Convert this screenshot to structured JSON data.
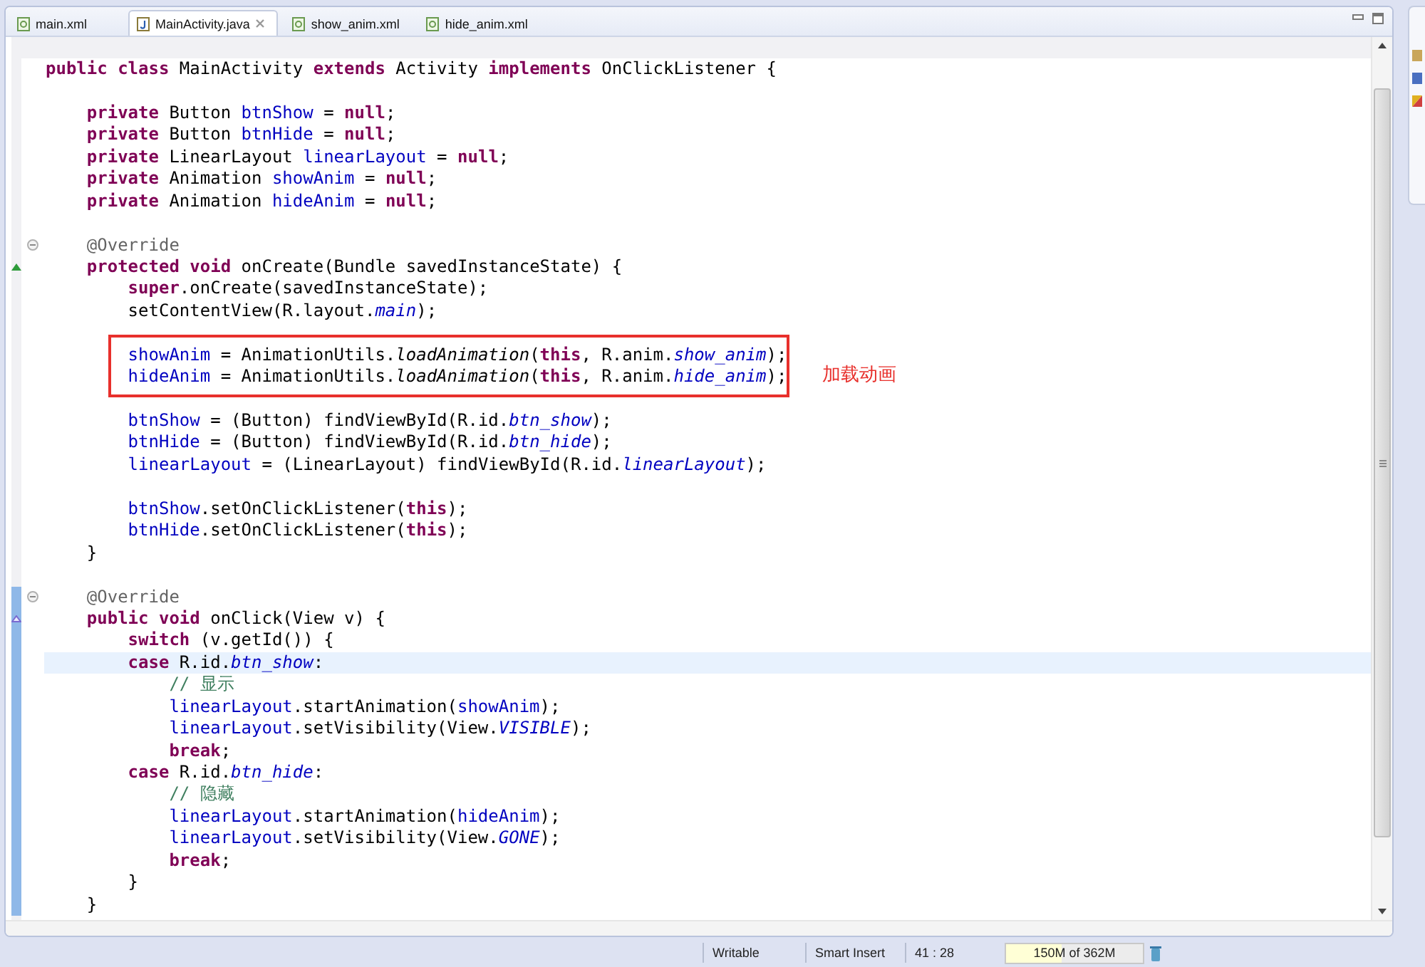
{
  "tabs": [
    {
      "label": "main.xml",
      "kind": "xml",
      "selected": false
    },
    {
      "label": "MainActivity.java",
      "kind": "java",
      "selected": true
    },
    {
      "label": "show_anim.xml",
      "kind": "xml",
      "selected": false
    },
    {
      "label": "hide_anim.xml",
      "kind": "xml",
      "selected": false
    }
  ],
  "editor": {
    "blocks": [
      {
        "range": false,
        "boxed": false,
        "lines": [
          {
            "kind": "code",
            "tokens": [
              {
                "kind": "keyword",
                "text": "public class "
              },
              {
                "kind": "plain",
                "text": "MainActivity "
              },
              {
                "kind": "keyword",
                "text": "extends "
              },
              {
                "kind": "plain",
                "text": "Activity "
              },
              {
                "kind": "keyword",
                "text": "implements "
              },
              {
                "kind": "plain",
                "text": "OnClickListener {"
              }
            ],
            "current": false
          },
          {
            "kind": "blank"
          },
          {
            "kind": "code",
            "tokens": [
              {
                "kind": "keyword",
                "text": "    private "
              },
              {
                "kind": "plain",
                "text": "Button "
              },
              {
                "kind": "field",
                "text": "btnShow"
              },
              {
                "kind": "plain",
                "text": " = "
              },
              {
                "kind": "keyword",
                "text": "null"
              },
              {
                "kind": "plain",
                "text": ";"
              }
            ],
            "current": false
          },
          {
            "kind": "code",
            "tokens": [
              {
                "kind": "keyword",
                "text": "    private "
              },
              {
                "kind": "plain",
                "text": "Button "
              },
              {
                "kind": "field",
                "text": "btnHide"
              },
              {
                "kind": "plain",
                "text": " = "
              },
              {
                "kind": "keyword",
                "text": "null"
              },
              {
                "kind": "plain",
                "text": ";"
              }
            ],
            "current": false
          },
          {
            "kind": "code",
            "tokens": [
              {
                "kind": "keyword",
                "text": "    private "
              },
              {
                "kind": "plain",
                "text": "LinearLayout "
              },
              {
                "kind": "field",
                "text": "linearLayout"
              },
              {
                "kind": "plain",
                "text": " = "
              },
              {
                "kind": "keyword",
                "text": "null"
              },
              {
                "kind": "plain",
                "text": ";"
              }
            ],
            "current": false
          },
          {
            "kind": "code",
            "tokens": [
              {
                "kind": "keyword",
                "text": "    private "
              },
              {
                "kind": "plain",
                "text": "Animation "
              },
              {
                "kind": "field",
                "text": "showAnim"
              },
              {
                "kind": "plain",
                "text": " = "
              },
              {
                "kind": "keyword",
                "text": "null"
              },
              {
                "kind": "plain",
                "text": ";"
              }
            ],
            "current": false
          },
          {
            "kind": "code",
            "tokens": [
              {
                "kind": "keyword",
                "text": "    private "
              },
              {
                "kind": "plain",
                "text": "Animation "
              },
              {
                "kind": "field",
                "text": "hideAnim"
              },
              {
                "kind": "plain",
                "text": " = "
              },
              {
                "kind": "keyword",
                "text": "null"
              },
              {
                "kind": "plain",
                "text": ";"
              }
            ],
            "current": false
          },
          {
            "kind": "blank"
          },
          {
            "kind": "fold",
            "tokens": [
              {
                "kind": "annotation",
                "text": "    @Override"
              }
            ],
            "current": false
          },
          {
            "kind": "override",
            "tokens": [
              {
                "kind": "keyword",
                "text": "    protected void "
              },
              {
                "kind": "plain",
                "text": "onCreate(Bundle savedInstanceState) {"
              }
            ],
            "current": false
          },
          {
            "kind": "code",
            "tokens": [
              {
                "kind": "keyword",
                "text": "        super"
              },
              {
                "kind": "plain",
                "text": ".onCreate(savedInstanceState);"
              }
            ],
            "current": false
          },
          {
            "kind": "code",
            "tokens": [
              {
                "kind": "plain",
                "text": "        setContentView(R.layout."
              },
              {
                "kind": "static",
                "text": "main"
              },
              {
                "kind": "plain",
                "text": ");"
              }
            ],
            "current": false
          },
          {
            "kind": "blank"
          }
        ]
      },
      {
        "range": false,
        "boxed": true,
        "callout": "加载动画",
        "lines": [
          {
            "kind": "code",
            "tokens": [
              {
                "kind": "field",
                "text": "        showAnim"
              },
              {
                "kind": "plain",
                "text": " = AnimationUtils."
              },
              {
                "kind": "static-method",
                "text": "loadAnimation"
              },
              {
                "kind": "plain",
                "text": "("
              },
              {
                "kind": "keyword",
                "text": "this"
              },
              {
                "kind": "plain",
                "text": ", R.anim."
              },
              {
                "kind": "static",
                "text": "show_anim"
              },
              {
                "kind": "plain",
                "text": ");"
              }
            ],
            "current": false
          },
          {
            "kind": "code",
            "tokens": [
              {
                "kind": "field",
                "text": "        hideAnim"
              },
              {
                "kind": "plain",
                "text": " = AnimationUtils."
              },
              {
                "kind": "static-method",
                "text": "loadAnimation"
              },
              {
                "kind": "plain",
                "text": "("
              },
              {
                "kind": "keyword",
                "text": "this"
              },
              {
                "kind": "plain",
                "text": ", R.anim."
              },
              {
                "kind": "static",
                "text": "hide_anim"
              },
              {
                "kind": "plain",
                "text": ");"
              }
            ],
            "current": false
          }
        ]
      },
      {
        "range": false,
        "boxed": false,
        "lines": [
          {
            "kind": "blank"
          },
          {
            "kind": "code",
            "tokens": [
              {
                "kind": "field",
                "text": "        btnShow"
              },
              {
                "kind": "plain",
                "text": " = (Button) findViewById(R.id."
              },
              {
                "kind": "static",
                "text": "btn_show"
              },
              {
                "kind": "plain",
                "text": ");"
              }
            ],
            "current": false
          },
          {
            "kind": "code",
            "tokens": [
              {
                "kind": "field",
                "text": "        btnHide"
              },
              {
                "kind": "plain",
                "text": " = (Button) findViewById(R.id."
              },
              {
                "kind": "static",
                "text": "btn_hide"
              },
              {
                "kind": "plain",
                "text": ");"
              }
            ],
            "current": false
          },
          {
            "kind": "code",
            "tokens": [
              {
                "kind": "field",
                "text": "        linearLayout"
              },
              {
                "kind": "plain",
                "text": " = (LinearLayout) findViewById(R.id."
              },
              {
                "kind": "static",
                "text": "linearLayout"
              },
              {
                "kind": "plain",
                "text": ");"
              }
            ],
            "current": false
          },
          {
            "kind": "blank"
          },
          {
            "kind": "code",
            "tokens": [
              {
                "kind": "field",
                "text": "        btnShow"
              },
              {
                "kind": "plain",
                "text": ".setOnClickListener("
              },
              {
                "kind": "keyword",
                "text": "this"
              },
              {
                "kind": "plain",
                "text": ");"
              }
            ],
            "current": false
          },
          {
            "kind": "code",
            "tokens": [
              {
                "kind": "field",
                "text": "        btnHide"
              },
              {
                "kind": "plain",
                "text": ".setOnClickListener("
              },
              {
                "kind": "keyword",
                "text": "this"
              },
              {
                "kind": "plain",
                "text": ");"
              }
            ],
            "current": false
          },
          {
            "kind": "code",
            "tokens": [
              {
                "kind": "plain",
                "text": "    }"
              }
            ],
            "current": false
          },
          {
            "kind": "blank"
          }
        ]
      },
      {
        "range": true,
        "boxed": false,
        "lines": [
          {
            "kind": "fold",
            "tokens": [
              {
                "kind": "annotation",
                "text": "    @Override"
              }
            ],
            "current": false
          },
          {
            "kind": "implement",
            "tokens": [
              {
                "kind": "keyword",
                "text": "    public void "
              },
              {
                "kind": "plain",
                "text": "onClick(View v) {"
              }
            ],
            "current": false
          },
          {
            "kind": "code",
            "tokens": [
              {
                "kind": "keyword",
                "text": "        switch "
              },
              {
                "kind": "plain",
                "text": "(v.getId()) {"
              }
            ],
            "current": false
          },
          {
            "kind": "code",
            "tokens": [
              {
                "kind": "keyword",
                "text": "        case "
              },
              {
                "kind": "plain",
                "text": "R.id."
              },
              {
                "kind": "static",
                "text": "btn_show"
              },
              {
                "kind": "plain",
                "text": ":"
              }
            ],
            "current": true
          },
          {
            "kind": "code",
            "tokens": [
              {
                "kind": "comment",
                "text": "            // 显示"
              }
            ],
            "current": false
          },
          {
            "kind": "code",
            "tokens": [
              {
                "kind": "field",
                "text": "            linearLayout"
              },
              {
                "kind": "plain",
                "text": ".startAnimation("
              },
              {
                "kind": "field",
                "text": "showAnim"
              },
              {
                "kind": "plain",
                "text": ");"
              }
            ],
            "current": false
          },
          {
            "kind": "code",
            "tokens": [
              {
                "kind": "field",
                "text": "            linearLayout"
              },
              {
                "kind": "plain",
                "text": ".setVisibility(View."
              },
              {
                "kind": "static",
                "text": "VISIBLE"
              },
              {
                "kind": "plain",
                "text": ");"
              }
            ],
            "current": false
          },
          {
            "kind": "code",
            "tokens": [
              {
                "kind": "keyword",
                "text": "            break"
              },
              {
                "kind": "plain",
                "text": ";"
              }
            ],
            "current": false
          },
          {
            "kind": "code",
            "tokens": [
              {
                "kind": "keyword",
                "text": "        case "
              },
              {
                "kind": "plain",
                "text": "R.id."
              },
              {
                "kind": "static",
                "text": "btn_hide"
              },
              {
                "kind": "plain",
                "text": ":"
              }
            ],
            "current": false
          },
          {
            "kind": "code",
            "tokens": [
              {
                "kind": "comment",
                "text": "            // 隐藏"
              }
            ],
            "current": false
          },
          {
            "kind": "code",
            "tokens": [
              {
                "kind": "field",
                "text": "            linearLayout"
              },
              {
                "kind": "plain",
                "text": ".startAnimation("
              },
              {
                "kind": "field",
                "text": "hideAnim"
              },
              {
                "kind": "plain",
                "text": ");"
              }
            ],
            "current": false
          },
          {
            "kind": "code",
            "tokens": [
              {
                "kind": "field",
                "text": "            linearLayout"
              },
              {
                "kind": "plain",
                "text": ".setVisibility(View."
              },
              {
                "kind": "static",
                "text": "GONE"
              },
              {
                "kind": "plain",
                "text": ");"
              }
            ],
            "current": false
          },
          {
            "kind": "code",
            "tokens": [
              {
                "kind": "keyword",
                "text": "            break"
              },
              {
                "kind": "plain",
                "text": ";"
              }
            ],
            "current": false
          },
          {
            "kind": "code",
            "tokens": [
              {
                "kind": "plain",
                "text": "        }"
              }
            ],
            "current": false
          },
          {
            "kind": "code",
            "tokens": [
              {
                "kind": "plain",
                "text": "    }"
              }
            ],
            "current": false
          }
        ]
      }
    ]
  },
  "status_bar": {
    "mode": "Writable",
    "insert": "Smart Insert",
    "position": "41 : 28",
    "memory": {
      "text": "150M of 362M",
      "level": 0.41
    }
  }
}
